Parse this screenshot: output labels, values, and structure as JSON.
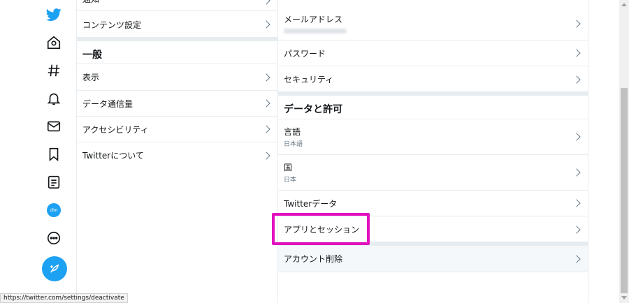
{
  "nav": {
    "icons": [
      "twitter-logo",
      "home-icon",
      "explore-hash-icon",
      "notifications-bell-icon",
      "messages-envelope-icon",
      "bookmarks-icon",
      "lists-icon",
      "profile-avatar",
      "more-icon",
      "compose-tweet-icon"
    ],
    "avatar_text": "dlm"
  },
  "settings": {
    "cutoff_label": "通知",
    "content_settings": "コンテンツ設定",
    "general_heading": "一般",
    "display": "表示",
    "data_usage": "データ通信量",
    "accessibility": "アクセシビリティ",
    "about_twitter": "Twitterについて"
  },
  "detail": {
    "email_label": "メールアドレス",
    "password": "パスワード",
    "security": "セキュリティ",
    "data_permissions_heading": "データと許可",
    "language_label": "言語",
    "language_value": "日本語",
    "country_label": "国",
    "country_value": "日本",
    "twitter_data": "Twitterデータ",
    "apps_sessions": "アプリとセッション",
    "deactivate": "アカウント削除"
  },
  "highlight_color": "#e20fbf",
  "accent_color": "#1da1f2",
  "status_url": "https://twitter.com/settings/deactivate"
}
